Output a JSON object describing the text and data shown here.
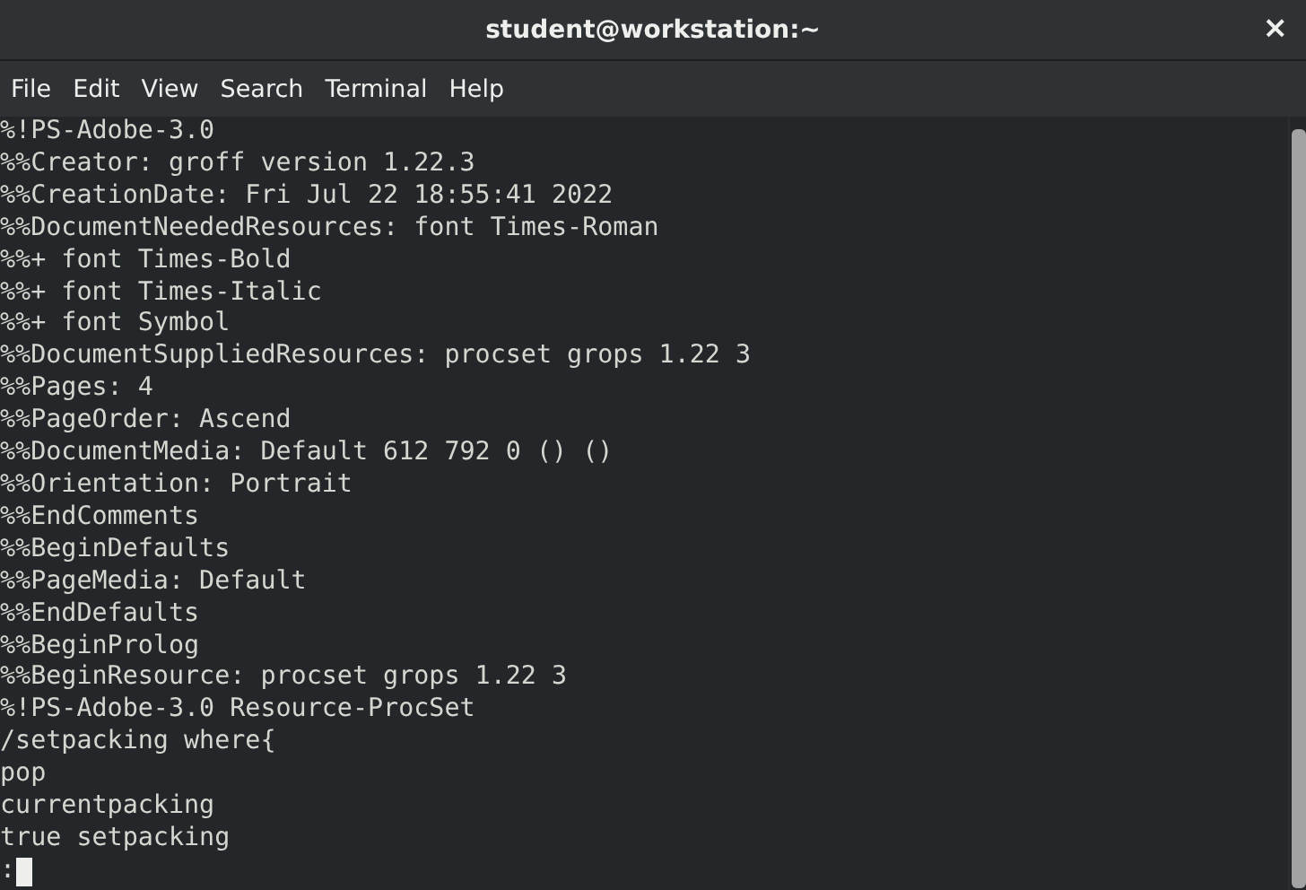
{
  "window": {
    "title": "student@workstation:~",
    "close": "×"
  },
  "menu": [
    "File",
    "Edit",
    "View",
    "Search",
    "Terminal",
    "Help"
  ],
  "terminal": {
    "lines": [
      "%!PS-Adobe-3.0",
      "%%Creator: groff version 1.22.3",
      "%%CreationDate: Fri Jul 22 18:55:41 2022",
      "%%DocumentNeededResources: font Times-Roman",
      "%%+ font Times-Bold",
      "%%+ font Times-Italic",
      "%%+ font Symbol",
      "%%DocumentSuppliedResources: procset grops 1.22 3",
      "%%Pages: 4",
      "%%PageOrder: Ascend",
      "%%DocumentMedia: Default 612 792 0 () ()",
      "%%Orientation: Portrait",
      "%%EndComments",
      "%%BeginDefaults",
      "%%PageMedia: Default",
      "%%EndDefaults",
      "%%BeginProlog",
      "%%BeginResource: procset grops 1.22 3",
      "%!PS-Adobe-3.0 Resource-ProcSet",
      "/setpacking where{",
      "pop",
      "currentpacking",
      "true setpacking"
    ],
    "prompt": ":"
  }
}
